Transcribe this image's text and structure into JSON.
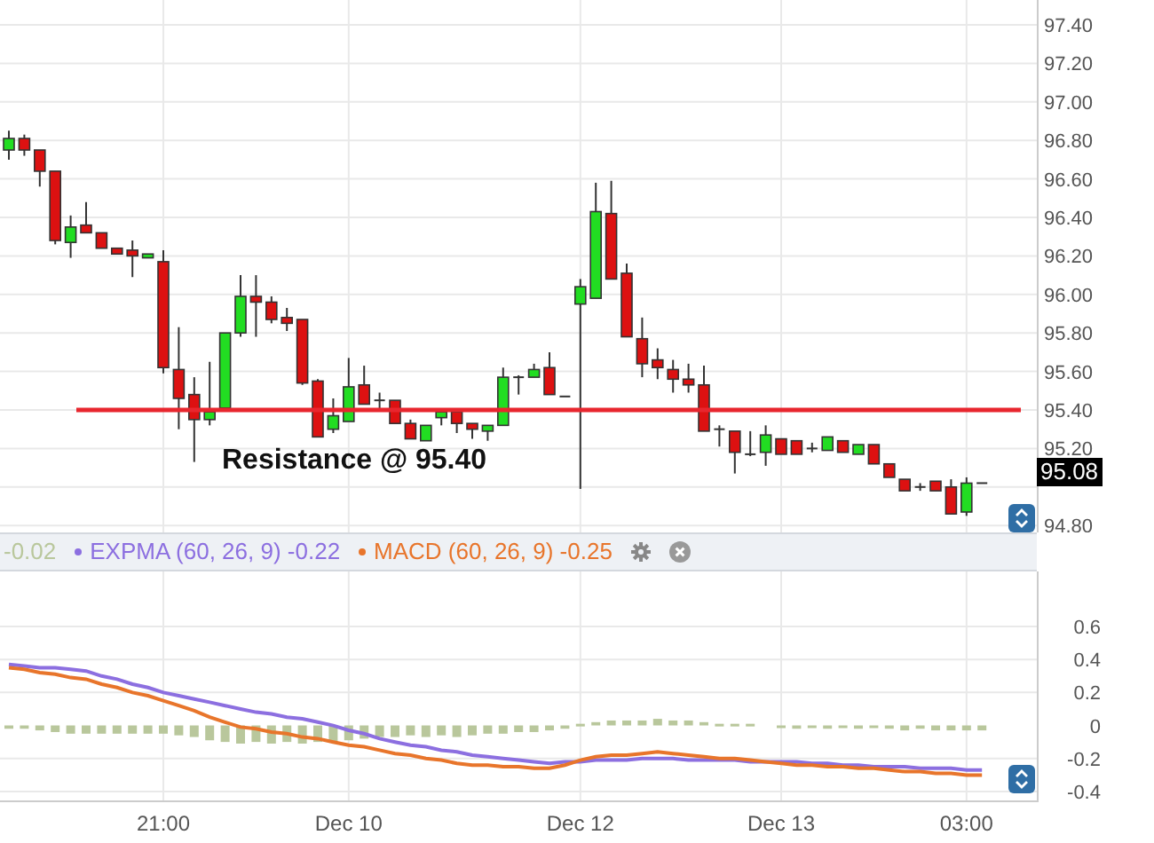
{
  "price_panel": {
    "chart_data": {
      "type": "candlestick",
      "grid": true,
      "ylim": [
        94.764,
        97.529
      ],
      "yticks": [
        {
          "value": 97.4,
          "label": "97.40"
        },
        {
          "value": 97.2,
          "label": "97.20"
        },
        {
          "value": 97.0,
          "label": "97.00"
        },
        {
          "value": 96.8,
          "label": "96.80"
        },
        {
          "value": 96.6,
          "label": "96.60"
        },
        {
          "value": 96.4,
          "label": "96.40"
        },
        {
          "value": 96.2,
          "label": "96.20"
        },
        {
          "value": 96.0,
          "label": "96.00"
        },
        {
          "value": 95.8,
          "label": "95.80"
        },
        {
          "value": 95.6,
          "label": "95.60"
        },
        {
          "value": 95.4,
          "label": "95.40"
        },
        {
          "value": 95.2,
          "label": "95.20"
        },
        {
          "value": 94.8,
          "label": "94.80"
        }
      ],
      "categories": [
        null,
        null,
        null,
        null,
        null,
        null,
        null,
        null,
        null,
        null,
        null,
        null,
        null,
        null,
        null,
        null,
        null,
        null,
        null,
        null,
        null,
        null,
        null,
        null,
        null,
        null,
        null,
        null,
        null,
        null,
        null,
        null,
        null,
        null,
        null,
        null,
        null,
        null,
        null,
        null,
        null,
        null,
        null,
        null,
        null,
        null,
        null,
        null,
        null,
        null,
        null,
        null,
        null,
        null,
        null,
        null,
        null,
        null,
        null,
        null,
        null,
        null,
        null,
        null
      ],
      "ohlc": [
        [
          96.75,
          96.85,
          96.7,
          96.81
        ],
        [
          96.81,
          96.83,
          96.72,
          96.75
        ],
        [
          96.75,
          96.75,
          96.56,
          96.64
        ],
        [
          96.64,
          96.64,
          96.26,
          96.28
        ],
        [
          96.27,
          96.41,
          96.19,
          96.35
        ],
        [
          96.36,
          96.48,
          96.32,
          96.32
        ],
        [
          96.32,
          96.32,
          96.24,
          96.24
        ],
        [
          96.24,
          96.24,
          96.21,
          96.21
        ],
        [
          96.23,
          96.28,
          96.09,
          96.2
        ],
        [
          96.19,
          96.21,
          96.19,
          96.21
        ],
        [
          96.17,
          96.23,
          95.59,
          95.62
        ],
        [
          95.61,
          95.83,
          95.3,
          95.46
        ],
        [
          95.48,
          95.57,
          95.13,
          95.35
        ],
        [
          95.35,
          95.65,
          95.32,
          95.39
        ],
        [
          95.41,
          95.8,
          95.4,
          95.8
        ],
        [
          95.8,
          96.1,
          95.78,
          95.99
        ],
        [
          95.99,
          96.1,
          95.78,
          95.96
        ],
        [
          95.96,
          95.99,
          95.85,
          95.87
        ],
        [
          95.88,
          95.93,
          95.81,
          95.85
        ],
        [
          95.87,
          95.87,
          95.53,
          95.54
        ],
        [
          95.55,
          95.56,
          95.26,
          95.26
        ],
        [
          95.3,
          95.46,
          95.28,
          95.37
        ],
        [
          95.34,
          95.67,
          95.34,
          95.52
        ],
        [
          95.53,
          95.63,
          95.43,
          95.43
        ],
        [
          95.45,
          95.49,
          95.4,
          95.44
        ],
        [
          95.45,
          95.45,
          95.33,
          95.33
        ],
        [
          95.33,
          95.35,
          95.25,
          95.25
        ],
        [
          95.24,
          95.32,
          95.24,
          95.32
        ],
        [
          95.36,
          95.39,
          95.32,
          95.39
        ],
        [
          95.39,
          95.39,
          95.28,
          95.33
        ],
        [
          95.33,
          95.33,
          95.25,
          95.3
        ],
        [
          95.29,
          95.32,
          95.24,
          95.32
        ],
        [
          95.32,
          95.62,
          95.32,
          95.57
        ],
        [
          95.57,
          95.58,
          95.48,
          95.56
        ],
        [
          95.57,
          95.64,
          95.57,
          95.61
        ],
        [
          95.62,
          95.7,
          95.48,
          95.48
        ],
        [
          95.47,
          95.47,
          95.47,
          95.47
        ],
        [
          95.95,
          96.08,
          94.99,
          96.04
        ],
        [
          95.98,
          96.58,
          95.98,
          96.43
        ],
        [
          96.42,
          96.59,
          96.08,
          96.08
        ],
        [
          96.11,
          96.16,
          95.78,
          95.78
        ],
        [
          95.77,
          95.88,
          95.57,
          95.64
        ],
        [
          95.66,
          95.72,
          95.56,
          95.62
        ],
        [
          95.61,
          95.66,
          95.49,
          95.56
        ],
        [
          95.56,
          95.64,
          95.49,
          95.53
        ],
        [
          95.53,
          95.63,
          95.29,
          95.29
        ],
        [
          95.3,
          95.32,
          95.21,
          95.29
        ],
        [
          95.29,
          95.29,
          95.07,
          95.18
        ],
        [
          95.17,
          95.29,
          95.16,
          95.17
        ],
        [
          95.18,
          95.32,
          95.11,
          95.27
        ],
        [
          95.25,
          95.25,
          95.17,
          95.17
        ],
        [
          95.24,
          95.24,
          95.17,
          95.17
        ],
        [
          95.2,
          95.23,
          95.18,
          95.2
        ],
        [
          95.19,
          95.26,
          95.19,
          95.26
        ],
        [
          95.24,
          95.24,
          95.18,
          95.18
        ],
        [
          95.17,
          95.22,
          95.17,
          95.22
        ],
        [
          95.22,
          95.22,
          95.12,
          95.12
        ],
        [
          95.12,
          95.12,
          95.05,
          95.05
        ],
        [
          95.04,
          95.04,
          94.98,
          94.98
        ],
        [
          95.0,
          95.02,
          94.98,
          95.0
        ],
        [
          95.03,
          95.03,
          94.98,
          94.98
        ],
        [
          95.0,
          95.04,
          94.86,
          94.86
        ],
        [
          94.87,
          95.05,
          94.85,
          95.02
        ],
        [
          95.02,
          95.02,
          95.02,
          95.02
        ]
      ],
      "ref_lines": [
        {
          "axis": "y",
          "value": 95.4,
          "label": "Resistance @ 95.40",
          "color": "#e8262e"
        }
      ]
    },
    "last_price_tag": "95.08"
  },
  "macd_panel": {
    "chart_data": {
      "type": "line",
      "grid": true,
      "ylim": [
        -0.465,
        0.933
      ],
      "yticks": [
        0.6,
        0.4,
        0.2,
        0,
        -0.2,
        -0.4
      ],
      "categories": [
        null,
        null,
        null,
        null,
        null,
        null,
        null,
        null,
        null,
        null,
        "21:00",
        null,
        null,
        null,
        null,
        null,
        null,
        null,
        null,
        null,
        null,
        null,
        "Dec 10",
        null,
        null,
        null,
        null,
        null,
        null,
        null,
        null,
        null,
        null,
        null,
        null,
        null,
        null,
        "Dec 12",
        null,
        null,
        null,
        null,
        null,
        null,
        null,
        null,
        null,
        null,
        null,
        null,
        "Dec 13",
        null,
        null,
        null,
        null,
        null,
        null,
        null,
        null,
        null,
        null,
        null,
        "03:00",
        null
      ],
      "series": [
        {
          "name": "-0.02",
          "type": "bar",
          "color": "#b9c79c",
          "values": [
            -0.02,
            -0.02,
            -0.03,
            -0.04,
            -0.05,
            -0.05,
            -0.05,
            -0.05,
            -0.05,
            -0.05,
            -0.05,
            -0.06,
            -0.07,
            -0.09,
            -0.1,
            -0.11,
            -0.1,
            -0.11,
            -0.1,
            -0.11,
            -0.1,
            -0.1,
            -0.09,
            -0.08,
            -0.07,
            -0.07,
            -0.06,
            -0.07,
            -0.06,
            -0.07,
            -0.06,
            -0.05,
            -0.05,
            -0.04,
            -0.04,
            -0.03,
            -0.02,
            0.01,
            0.02,
            0.03,
            0.03,
            0.03,
            0.04,
            0.03,
            0.03,
            0.02,
            0.01,
            0.01,
            0.01,
            0,
            -0.01,
            -0.02,
            -0.01,
            -0.02,
            -0.01,
            -0.02,
            -0.01,
            -0.02,
            -0.03,
            -0.02,
            -0.03,
            -0.03,
            -0.03,
            -0.03
          ]
        },
        {
          "name": "EXPMA (60, 26, 9) -0.22",
          "type": "line",
          "color": "#8c6fe0",
          "values": [
            0.37,
            0.36,
            0.35,
            0.35,
            0.34,
            0.33,
            0.3,
            0.28,
            0.25,
            0.23,
            0.2,
            0.18,
            0.16,
            0.14,
            0.12,
            0.1,
            0.08,
            0.07,
            0.05,
            0.04,
            0.02,
            0,
            -0.03,
            -0.05,
            -0.08,
            -0.1,
            -0.12,
            -0.13,
            -0.15,
            -0.16,
            -0.18,
            -0.19,
            -0.2,
            -0.21,
            -0.22,
            -0.23,
            -0.22,
            -0.22,
            -0.21,
            -0.21,
            -0.21,
            -0.2,
            -0.2,
            -0.2,
            -0.21,
            -0.21,
            -0.21,
            -0.21,
            -0.22,
            -0.22,
            -0.22,
            -0.22,
            -0.23,
            -0.23,
            -0.24,
            -0.24,
            -0.25,
            -0.25,
            -0.25,
            -0.26,
            -0.26,
            -0.26,
            -0.27,
            -0.27
          ]
        },
        {
          "name": "MACD (60, 26, 9) -0.25",
          "type": "line",
          "color": "#e8752b",
          "values": [
            0.35,
            0.34,
            0.32,
            0.31,
            0.29,
            0.28,
            0.25,
            0.23,
            0.2,
            0.18,
            0.15,
            0.12,
            0.09,
            0.05,
            0.02,
            -0.01,
            -0.02,
            -0.04,
            -0.05,
            -0.07,
            -0.08,
            -0.1,
            -0.12,
            -0.13,
            -0.15,
            -0.17,
            -0.18,
            -0.2,
            -0.21,
            -0.23,
            -0.24,
            -0.24,
            -0.25,
            -0.25,
            -0.26,
            -0.26,
            -0.24,
            -0.21,
            -0.19,
            -0.18,
            -0.18,
            -0.17,
            -0.16,
            -0.17,
            -0.18,
            -0.19,
            -0.2,
            -0.2,
            -0.21,
            -0.22,
            -0.23,
            -0.24,
            -0.24,
            -0.25,
            -0.25,
            -0.26,
            -0.26,
            -0.27,
            -0.28,
            -0.28,
            -0.29,
            -0.29,
            -0.3,
            -0.3
          ]
        }
      ]
    }
  }
}
